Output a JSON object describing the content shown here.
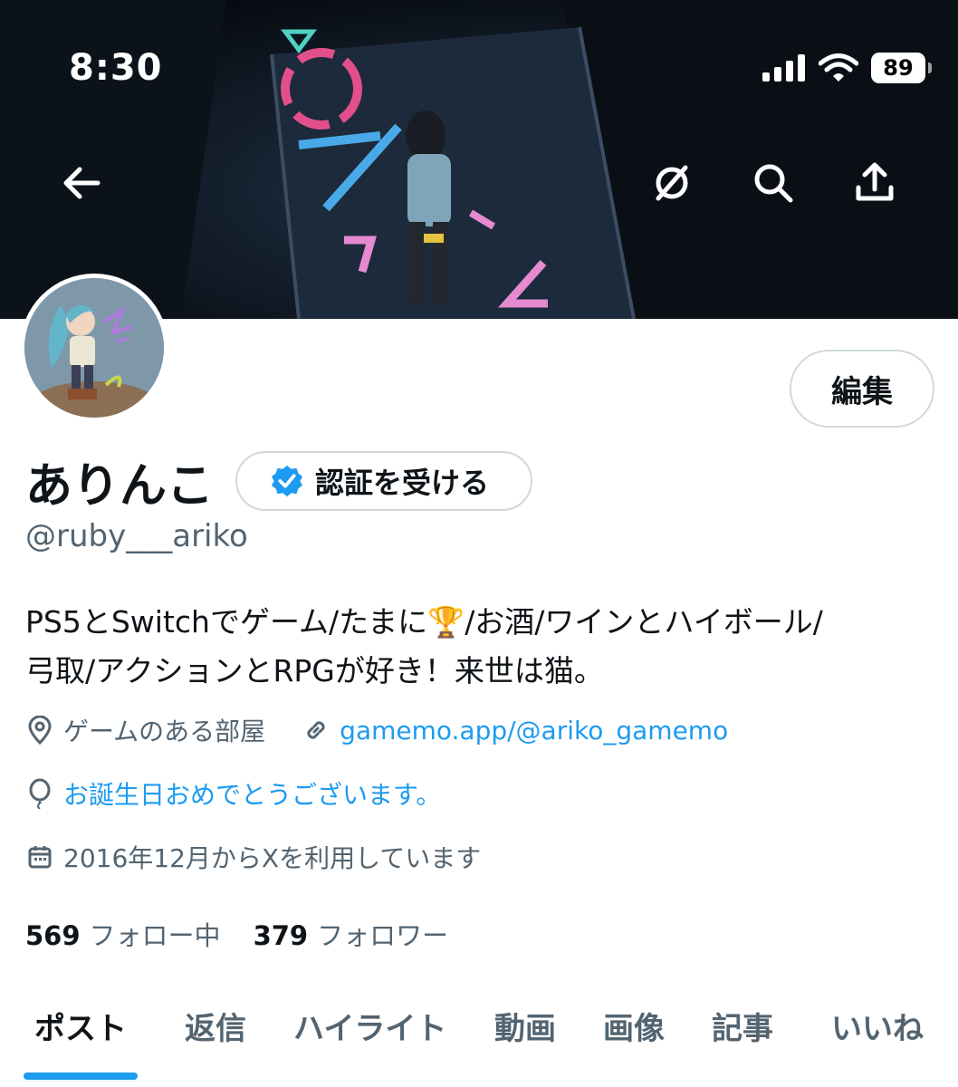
{
  "status_bar": {
    "time": "8:30",
    "battery": "89"
  },
  "header": {
    "back_icon": "arrow-left-icon",
    "grok_icon": "grok-icon",
    "search_icon": "search-icon",
    "share_icon": "share-icon"
  },
  "profile": {
    "display_name": "ありんこ",
    "verify_label": "認証を受ける",
    "handle": "@ruby___ariko",
    "edit_label": "編集",
    "bio_line1_a": "PS5とSwitchでゲーム/たまに",
    "bio_emoji": "🏆",
    "bio_line1_b": "/お酒/ワインとハイボール/",
    "bio_line2": "弓取/アクションとRPGが好き！来世は猫。",
    "location": "ゲームのある部屋",
    "website": "gamemo.app/@ariko_gamemo",
    "birthday": "お誕生日おめでとうございます。",
    "joined": "2016年12月からXを利用しています",
    "following_count": "569",
    "following_label": "フォロー中",
    "followers_count": "379",
    "followers_label": "フォロワー"
  },
  "tabs": [
    "ポスト",
    "返信",
    "ハイライト",
    "動画",
    "画像",
    "記事",
    "いいね"
  ],
  "colors": {
    "accent": "#1d9bf0",
    "text": "#0f1419",
    "muted": "#536471"
  }
}
